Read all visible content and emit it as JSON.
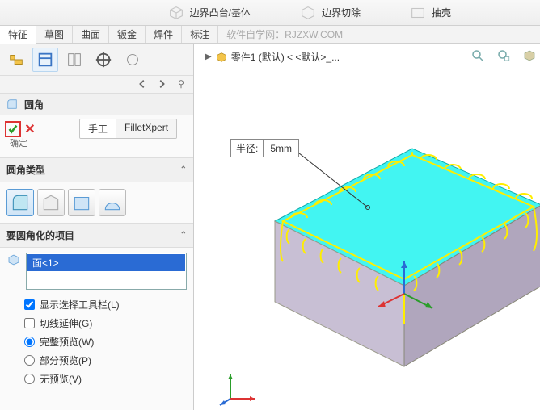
{
  "ribbon": {
    "extrude": "边界凸台/基体",
    "cut": "边界切除",
    "shell": "抽壳"
  },
  "tabs": [
    "特征",
    "草图",
    "曲面",
    "钣金",
    "焊件",
    "标注"
  ],
  "watermark": "软件自学网：RJZXW.COM",
  "crumb": {
    "part": "零件1 (默认) < <默认>_..."
  },
  "pm": {
    "title": "圆角",
    "confirm": "确定",
    "subtabs": [
      "手工",
      "FilletXpert"
    ],
    "type_label": "圆角类型",
    "items_label": "要圆角化的项目",
    "selection": "面<1>",
    "opt_toolbar": "显示选择工具栏(L)",
    "opt_tangent": "切线延伸(G)",
    "opt_full": "完整预览(W)",
    "opt_partial": "部分预览(P)",
    "opt_none": "无预览(V)"
  },
  "dim": {
    "label": "半径:",
    "value": "5mm"
  }
}
